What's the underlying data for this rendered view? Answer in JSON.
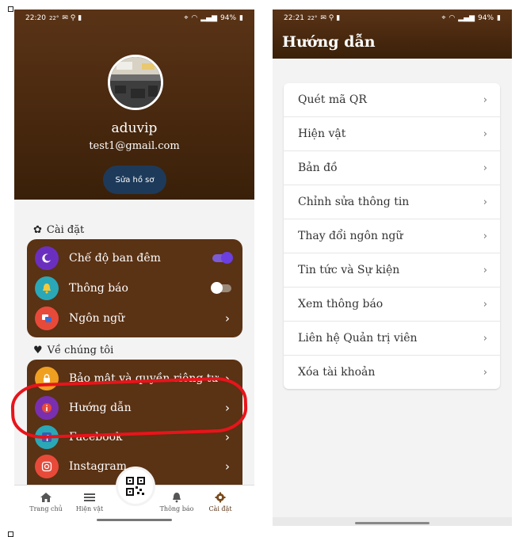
{
  "left_screen": {
    "status_bar": {
      "time": "22:20",
      "temp": "22°",
      "battery": "94%"
    },
    "profile": {
      "username": "aduvip",
      "email": "test1@gmail.com",
      "edit_button": "Sửa hồ sơ"
    },
    "settings_section": {
      "title": "Cài đặt",
      "items": [
        {
          "label": "Chế độ ban đêm",
          "icon": "moon-icon",
          "icon_color": "#6b2fc0",
          "control": "toggle-on"
        },
        {
          "label": "Thông báo",
          "icon": "bell-icon",
          "icon_color": "#2aa8b8",
          "control": "toggle-off"
        },
        {
          "label": "Ngôn ngữ",
          "icon": "language-icon",
          "icon_color": "#e84a3a",
          "control": "chevron"
        }
      ]
    },
    "about_section": {
      "title": "Về chúng tôi",
      "items": [
        {
          "label": "Bảo mật và quyền riêng tư",
          "icon": "lock-icon",
          "icon_color": "#f0a020"
        },
        {
          "label": "Hướng dẫn",
          "icon": "info-icon",
          "icon_color": "#7a2fb0"
        },
        {
          "label": "Facebook",
          "icon": "facebook-icon",
          "icon_color": "#2aa8b8"
        },
        {
          "label": "Instagram",
          "icon": "instagram-icon",
          "icon_color": "#e84a3a"
        }
      ]
    },
    "bottom_nav": [
      {
        "label": "Trang chủ",
        "icon": "home-icon"
      },
      {
        "label": "Hiện vật",
        "icon": "list-icon"
      },
      {
        "label": "Thông báo",
        "icon": "bell-icon"
      },
      {
        "label": "Cài đặt",
        "icon": "gear-icon"
      }
    ],
    "chevron": "›"
  },
  "right_screen": {
    "status_bar": {
      "time": "22:21",
      "temp": "22°",
      "battery": "94%"
    },
    "title": "Hướng dẫn",
    "items": [
      "Quét mã QR",
      "Hiện vật",
      "Bản đồ",
      "Chỉnh sửa thông tin",
      "Thay đổi ngôn ngữ",
      "Tin tức và Sự kiện",
      "Xem thông báo",
      "Liên hệ Quản trị viên",
      "Xóa tài khoản"
    ],
    "chevron": "›"
  },
  "colors": {
    "brand_brown": "#5a3214",
    "highlight_red": "#e8141b",
    "button_navy": "#1e3a5a"
  }
}
